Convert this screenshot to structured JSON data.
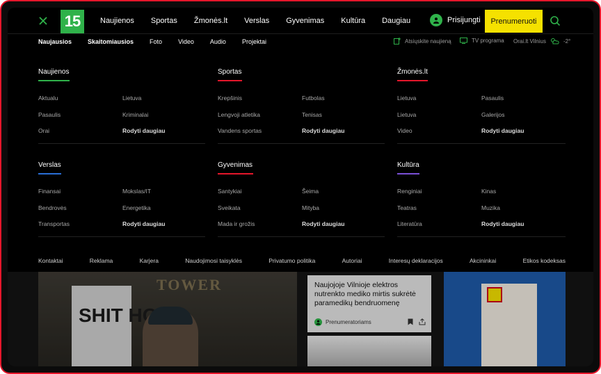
{
  "header": {
    "logo": "15",
    "nav": [
      "Naujienos",
      "Sportas",
      "Žmonės.lt",
      "Verslas",
      "Gyvenimas",
      "Kultūra",
      "Daugiau"
    ],
    "login_label": "Prisijungti",
    "subscribe_label": "Prenumeruoti"
  },
  "subnav": {
    "items": [
      "Naujausios",
      "Skaitomiausios",
      "Foto",
      "Video",
      "Audio",
      "Projektai"
    ],
    "send_news": "Atsiųskite naujieną",
    "tv_program": "TV programa",
    "weather_city": "Orai.lt Vilnius",
    "weather_temp": "-2°"
  },
  "menu": {
    "sections": [
      {
        "title": "Naujienos",
        "accent": "#2fb24a",
        "links": [
          "Aktualu",
          "Lietuva",
          "Pasaulis",
          "Kriminalai",
          "Orai",
          "Rodyti daugiau"
        ]
      },
      {
        "title": "Sportas",
        "accent": "#e5162b",
        "links": [
          "Krepšinis",
          "Futbolas",
          "Lengvoji atletika",
          "Tenisas",
          "Vandens sportas",
          "Rodyti daugiau"
        ]
      },
      {
        "title": "Žmonės.lt",
        "accent": "#e5162b",
        "links": [
          "Lietuva",
          "Pasaulis",
          "Lietuva",
          "Galerijos",
          "Video",
          "Rodyti daugiau"
        ]
      },
      {
        "title": "Verslas",
        "accent": "#2a6fd6",
        "links": [
          "Finansai",
          "Mokslas/IT",
          "Bendrovės",
          "Energetika",
          "Transportas",
          "Rodyti daugiau"
        ]
      },
      {
        "title": "Gyvenimas",
        "accent": "#e5162b",
        "links": [
          "Santykiai",
          "Šeima",
          "Sveikata",
          "Mityba",
          "Mada ir grožis",
          "Rodyti daugiau"
        ]
      },
      {
        "title": "Kultūra",
        "accent": "#7a4fd6",
        "links": [
          "Renginiai",
          "Kinas",
          "Teatras",
          "Muzika",
          "Literatūra",
          "Rodyti daugiau"
        ]
      }
    ]
  },
  "footer": {
    "links": [
      "Kontaktai",
      "Reklama",
      "Karjera",
      "Naudojimosi taisyklės",
      "Privatumo politika",
      "Autoriai",
      "Interesų deklaracijos",
      "Akcininkai",
      "Etikos kodeksas"
    ]
  },
  "background": {
    "photo_text": "TOWER",
    "sign_text": "SHIT HOLE",
    "article_title": "Naujojoje Vilnioje elektros nutrenkto mediko mirtis sukrėtė paramedikų bendruomenę",
    "article_badge": "Prenumeratoriams"
  },
  "colors": {
    "brand_green": "#2fb24a",
    "subscribe_yellow": "#f5e100",
    "frame_red": "#e5162b"
  }
}
